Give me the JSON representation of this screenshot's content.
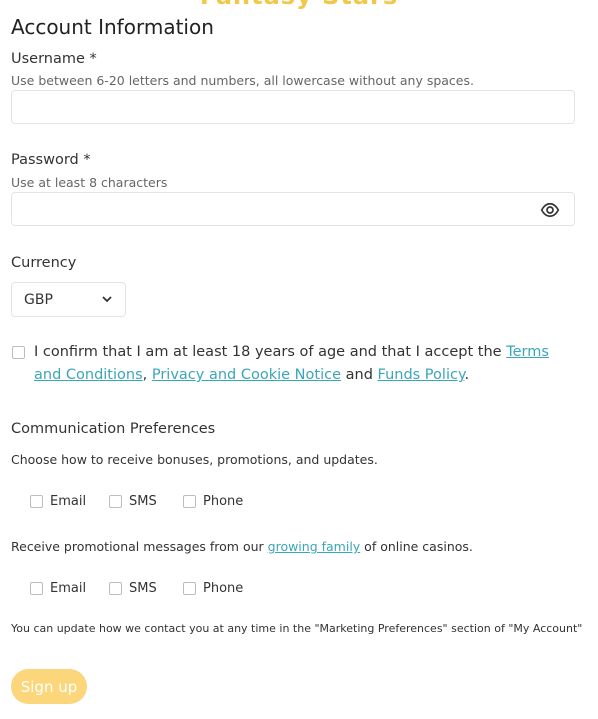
{
  "header": {
    "top_cut_text": "Fantasy Stars",
    "section_title": "Account Information"
  },
  "username": {
    "label": "Username *",
    "hint": "Use between 6-20 letters and numbers, all lowercase without any spaces.",
    "value": ""
  },
  "password": {
    "label": "Password *",
    "hint": "Use at least 8 characters",
    "value": "",
    "icon": "eye-icon"
  },
  "currency": {
    "label": "Currency",
    "selected": "GBP",
    "icon": "chevron-down-icon"
  },
  "terms": {
    "checked": false,
    "text_before": "I confirm that I am at least 18 years of age and that I accept the ",
    "link1": "Terms and Conditions",
    "sep1": ", ",
    "link2": "Privacy and Cookie Notice",
    "sep2": " and ",
    "link3": "Funds Policy",
    "text_after": "."
  },
  "communication": {
    "heading": "Communication Preferences",
    "desc1": "Choose how to receive bonuses, promotions, and updates.",
    "options1": [
      "Email",
      "SMS",
      "Phone"
    ],
    "desc2_before": "Receive promotional messages from our ",
    "desc2_link": "growing family",
    "desc2_after": " of online casinos.",
    "options2": [
      "Email",
      "SMS",
      "Phone"
    ],
    "footnote": "You can update how we contact you at any time in the \"Marketing Preferences\" section of \"My Account\""
  },
  "signup_label": "Sign up",
  "colors": {
    "accent": "#fbd67a",
    "link": "#3aa6b9",
    "border": "#e3e3e3"
  }
}
